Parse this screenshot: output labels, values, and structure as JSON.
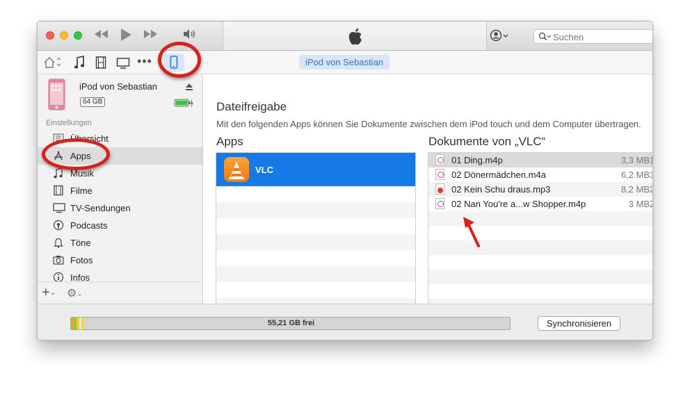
{
  "colors": {
    "selection": "#1679e8",
    "accent": "#3a70bd",
    "annotation": "#d7211b"
  },
  "titlebar": {
    "traffic_lights": [
      "close",
      "minimize",
      "zoom"
    ],
    "playback_icons": [
      "rewind-icon",
      "play-icon",
      "fast-forward-icon",
      "volume-icon"
    ],
    "center_icon": "apple-logo",
    "account_icon": "user-icon",
    "search": {
      "placeholder": "Suchen",
      "value": ""
    }
  },
  "toolbar": {
    "media_icons": [
      "home-icon",
      "music-note-icon",
      "film-icon",
      "tv-icon",
      "more-icon",
      "iphone-icon"
    ],
    "device_button": "iPod von Sebastian"
  },
  "sidebar": {
    "device": {
      "name": "iPod von Sebastian",
      "capacity": "64 GB"
    },
    "section_label": "Einstellungen",
    "items": [
      {
        "label": "Übersicht",
        "icon": "summary-icon"
      },
      {
        "label": "Apps",
        "icon": "apps-icon"
      },
      {
        "label": "Musik",
        "icon": "music-icon"
      },
      {
        "label": "Filme",
        "icon": "film-icon"
      },
      {
        "label": "TV-Sendungen",
        "icon": "tv-icon"
      },
      {
        "label": "Podcasts",
        "icon": "podcast-icon"
      },
      {
        "label": "Töne",
        "icon": "bell-icon"
      },
      {
        "label": "Fotos",
        "icon": "camera-icon"
      },
      {
        "label": "Infos",
        "icon": "info-icon"
      }
    ],
    "bottom_icons": [
      "plus-icon",
      "gear-icon"
    ]
  },
  "main": {
    "section_title": "Dateifreigabe",
    "description": "Mit den folgenden Apps können Sie Dokumente zwischen dem iPod touch und dem Computer übertragen.",
    "apps_heading": "Apps",
    "apps": [
      {
        "name": "VLC",
        "icon": "vlc-cone-icon"
      }
    ],
    "documents_heading": "Dokumente von „VLC“",
    "documents": [
      {
        "name": "01 Ding.m4p",
        "size": "3,3 MB",
        "trail": "1"
      },
      {
        "name": "02 Dönermädchen.m4a",
        "size": "6,2 MB",
        "trail": "3"
      },
      {
        "name": "02 Kein Schu draus.mp3",
        "size": "8,2 MB",
        "trail": "2"
      },
      {
        "name": "02 Nan You're a...w Shopper.m4p",
        "size": "3 MB",
        "trail": "2"
      }
    ]
  },
  "statusbar": {
    "free_space": "55,21 GB frei",
    "sync_button": "Synchronisieren"
  }
}
